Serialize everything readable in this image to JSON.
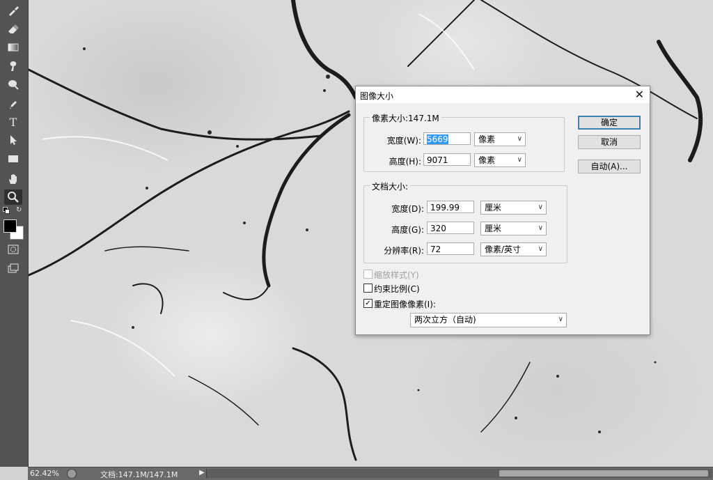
{
  "toolbar": {
    "tools": [
      {
        "name": "brush-icon"
      },
      {
        "name": "eraser-icon"
      },
      {
        "name": "gradient-icon"
      },
      {
        "name": "smudge-icon"
      },
      {
        "name": "dodge-icon"
      },
      {
        "name": "pen-icon"
      },
      {
        "name": "type-icon",
        "glyph": "T"
      },
      {
        "name": "path-select-icon"
      },
      {
        "name": "rectangle-shape-icon"
      },
      {
        "name": "hand-icon"
      },
      {
        "name": "zoom-icon",
        "active": true
      }
    ],
    "foreground_color": "#000000",
    "background_color": "#ffffff"
  },
  "dialog": {
    "title": "图像大小",
    "pixel_dimensions": {
      "legend": "像素大小:147.1M",
      "width_label": "宽度(W):",
      "width_value": "5669",
      "width_unit": "像素",
      "height_label": "高度(H):",
      "height_value": "9071",
      "height_unit": "像素"
    },
    "document_size": {
      "legend": "文档大小:",
      "width_label": "宽度(D):",
      "width_value": "199.99",
      "width_unit": "厘米",
      "height_label": "高度(G):",
      "height_value": "320",
      "height_unit": "厘米",
      "resolution_label": "分辨率(R):",
      "resolution_value": "72",
      "resolution_unit": "像素/英寸"
    },
    "options": {
      "scale_styles": "缩放样式(Y)",
      "scale_styles_checked": false,
      "scale_styles_enabled": false,
      "constrain": "约束比例(C)",
      "constrain_checked": false,
      "resample": "重定图像像素(I):",
      "resample_checked": true,
      "resample_method": "两次立方（自动)"
    },
    "buttons": {
      "ok": "确定",
      "cancel": "取消",
      "auto": "自动(A)..."
    }
  },
  "statusbar": {
    "zoom": "62.42%",
    "doc_info": "文档:147.1M/147.1M"
  }
}
